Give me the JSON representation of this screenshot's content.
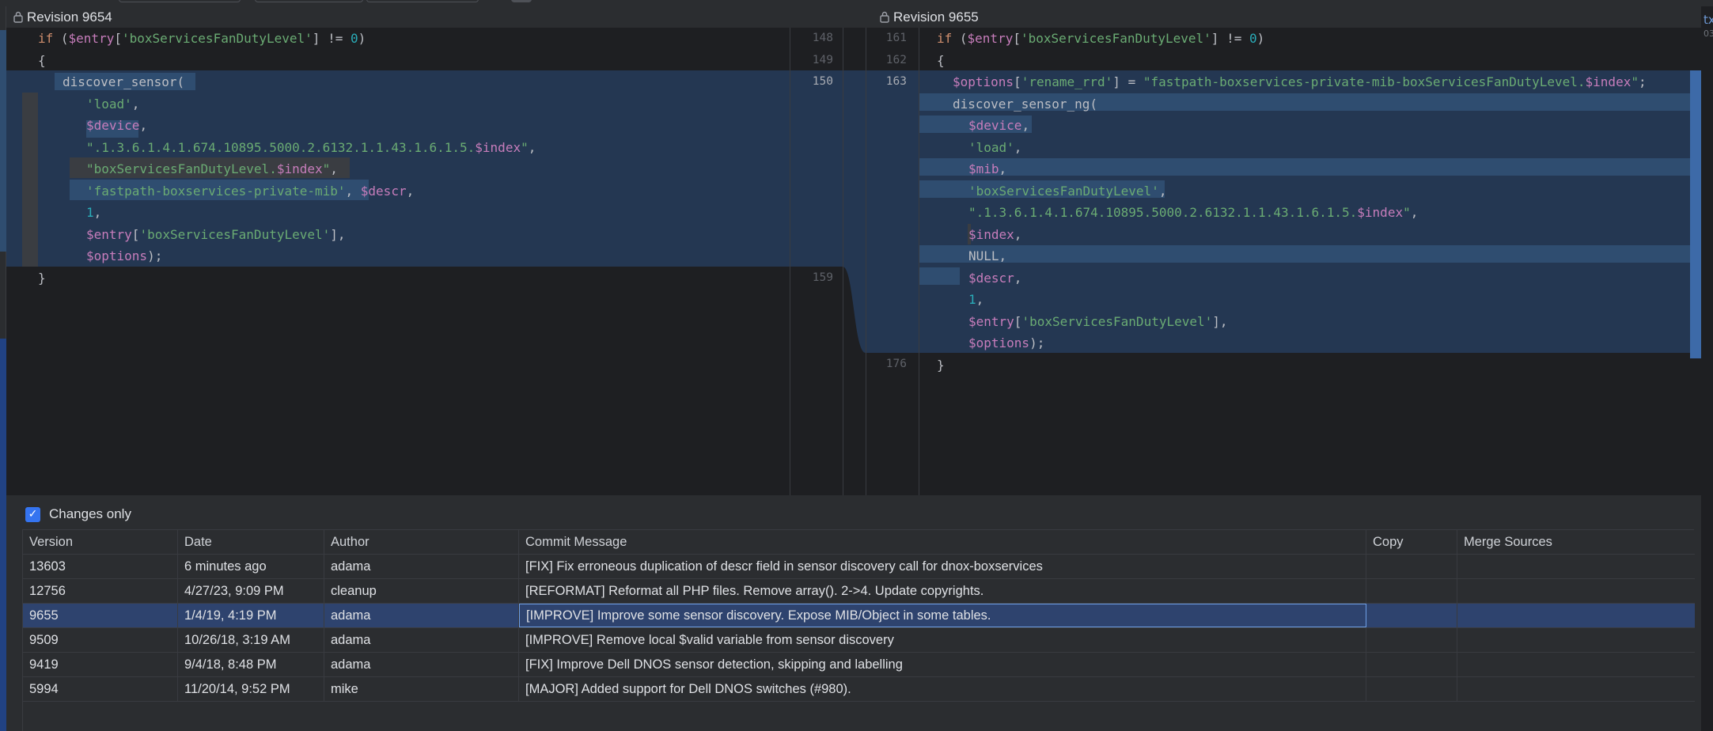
{
  "left_pane": {
    "title": "Revision 9654",
    "lines": [
      {
        "num": "148"
      },
      {
        "num": "149"
      },
      {
        "num": "150"
      },
      {
        "num": ""
      },
      {
        "num": ""
      },
      {
        "num": ""
      },
      {
        "num": ""
      },
      {
        "num": ""
      },
      {
        "num": ""
      },
      {
        "num": ""
      },
      {
        "num": ""
      },
      {
        "num": "159"
      }
    ],
    "code": {
      "l1_kw": "if",
      "l1_a": " (",
      "l1_var": "$entry",
      "l1_b": "[",
      "l1_str": "'boxServicesFanDutyLevel'",
      "l1_c": "] != ",
      "l1_num": "0",
      "l1_d": ")",
      "l2": "{",
      "l3": "discover_sensor(",
      "l4_str": "'load'",
      "l4_p": ",",
      "l5_var": "$device",
      "l5_p": ",",
      "l6_str": "\".1.3.6.1.4.1.674.10895.5000.2.6132.1.1.43.1.6.1.5.",
      "l6_var": "$index",
      "l6_str2": "\"",
      "l6_p": ",",
      "l7_str": "\"boxServicesFanDutyLevel.",
      "l7_var": "$index",
      "l7_str2": "\"",
      "l7_p": ",",
      "l8_str": "'fastpath-boxservices-private-mib'",
      "l8_p": ", ",
      "l8_var": "$descr",
      "l8_p2": ",",
      "l9_num": "1",
      "l9_p": ",",
      "l10_var": "$entry",
      "l10_a": "[",
      "l10_str": "'boxServicesFanDutyLevel'",
      "l10_b": "],",
      "l11_var": "$options",
      "l11_p": ");",
      "l12": "}"
    }
  },
  "right_pane": {
    "title": "Revision 9655",
    "lines": [
      {
        "num": "161"
      },
      {
        "num": "162"
      },
      {
        "num": "163"
      },
      {
        "num": ""
      },
      {
        "num": ""
      },
      {
        "num": ""
      },
      {
        "num": ""
      },
      {
        "num": ""
      },
      {
        "num": ""
      },
      {
        "num": ""
      },
      {
        "num": ""
      },
      {
        "num": ""
      },
      {
        "num": ""
      },
      {
        "num": ""
      },
      {
        "num": ""
      },
      {
        "num": "176"
      }
    ],
    "code": {
      "l1_kw": "if",
      "l1_a": " (",
      "l1_var": "$entry",
      "l1_b": "[",
      "l1_str": "'boxServicesFanDutyLevel'",
      "l1_c": "] != ",
      "l1_num": "0",
      "l1_d": ")",
      "l2": "{",
      "l3_var": "$options",
      "l3_a": "[",
      "l3_str": "'rename_rrd'",
      "l3_b": "] = ",
      "l3_str2": "\"fastpath-boxservices-private-mib-boxServicesFanDutyLevel.",
      "l3_var2": "$index",
      "l3_str3": "\"",
      "l3_p": ";",
      "l4": "discover_sensor_ng(",
      "l5_var": "$device",
      "l5_p": ",",
      "l6_str": "'load'",
      "l6_p": ",",
      "l7_var": "$mib",
      "l7_p": ",",
      "l8_str": "'boxServicesFanDutyLevel'",
      "l8_p": ",",
      "l9_str": "\".1.3.6.1.4.1.674.10895.5000.2.6132.1.1.43.1.6.1.5.",
      "l9_var": "$index",
      "l9_str2": "\"",
      "l9_p": ",",
      "l10_var": "$index",
      "l10_p": ",",
      "l11_kw": "NULL",
      "l11_p": ",",
      "l12_var": "$descr",
      "l12_p": ",",
      "l13_num": "1",
      "l13_p": ",",
      "l14_var": "$entry",
      "l14_a": "[",
      "l14_str": "'boxServicesFanDutyLevel'",
      "l14_b": "],",
      "l15_var": "$options",
      "l15_p": ");",
      "l16": "}"
    }
  },
  "history": {
    "changes_only_label": "Changes only",
    "changes_only_checked": true,
    "columns": [
      "Version",
      "Date",
      "Author",
      "Commit Message",
      "Copy",
      "Merge Sources"
    ],
    "rows": [
      {
        "version": "13603",
        "date": "6 minutes ago",
        "author": "adama",
        "message": "[FIX] Fix erroneous duplication of descr field in sensor discovery call for dnox-boxservices",
        "copy": "",
        "merge": ""
      },
      {
        "version": "12756",
        "date": "4/27/23, 9:09 PM",
        "author": "cleanup",
        "message": "[REFORMAT] Reformat all PHP files. Remove array(). 2->4. Update copyrights.",
        "copy": "",
        "merge": ""
      },
      {
        "version": "9655",
        "date": "1/4/19, 4:19 PM",
        "author": "adama",
        "message": "[IMPROVE] Improve some sensor discovery. Expose MIB/Object in some tables.",
        "copy": "",
        "merge": "",
        "selected": true
      },
      {
        "version": "9509",
        "date": "10/26/18, 3:19 AM",
        "author": "adama",
        "message": "[IMPROVE] Remove local $valid variable from sensor discovery",
        "copy": "",
        "merge": ""
      },
      {
        "version": "9419",
        "date": "9/4/18, 8:48 PM",
        "author": "adama",
        "message": "[FIX] Improve Dell DNOS sensor detection, skipping and labelling",
        "copy": "",
        "merge": ""
      },
      {
        "version": "5994",
        "date": "11/20/14, 9:52 PM",
        "author": "mike",
        "message": "[MAJOR] Added support for Dell DNOS switches (#980).",
        "copy": "",
        "merge": ""
      }
    ]
  },
  "edge_glyphs": {
    "right_top": "tx",
    "right_top2": "03"
  },
  "colors": {
    "accent": "#3574f0",
    "diff_modified": "#243752",
    "diff_strong": "#2f4d70",
    "selected_row": "#2e436e"
  }
}
